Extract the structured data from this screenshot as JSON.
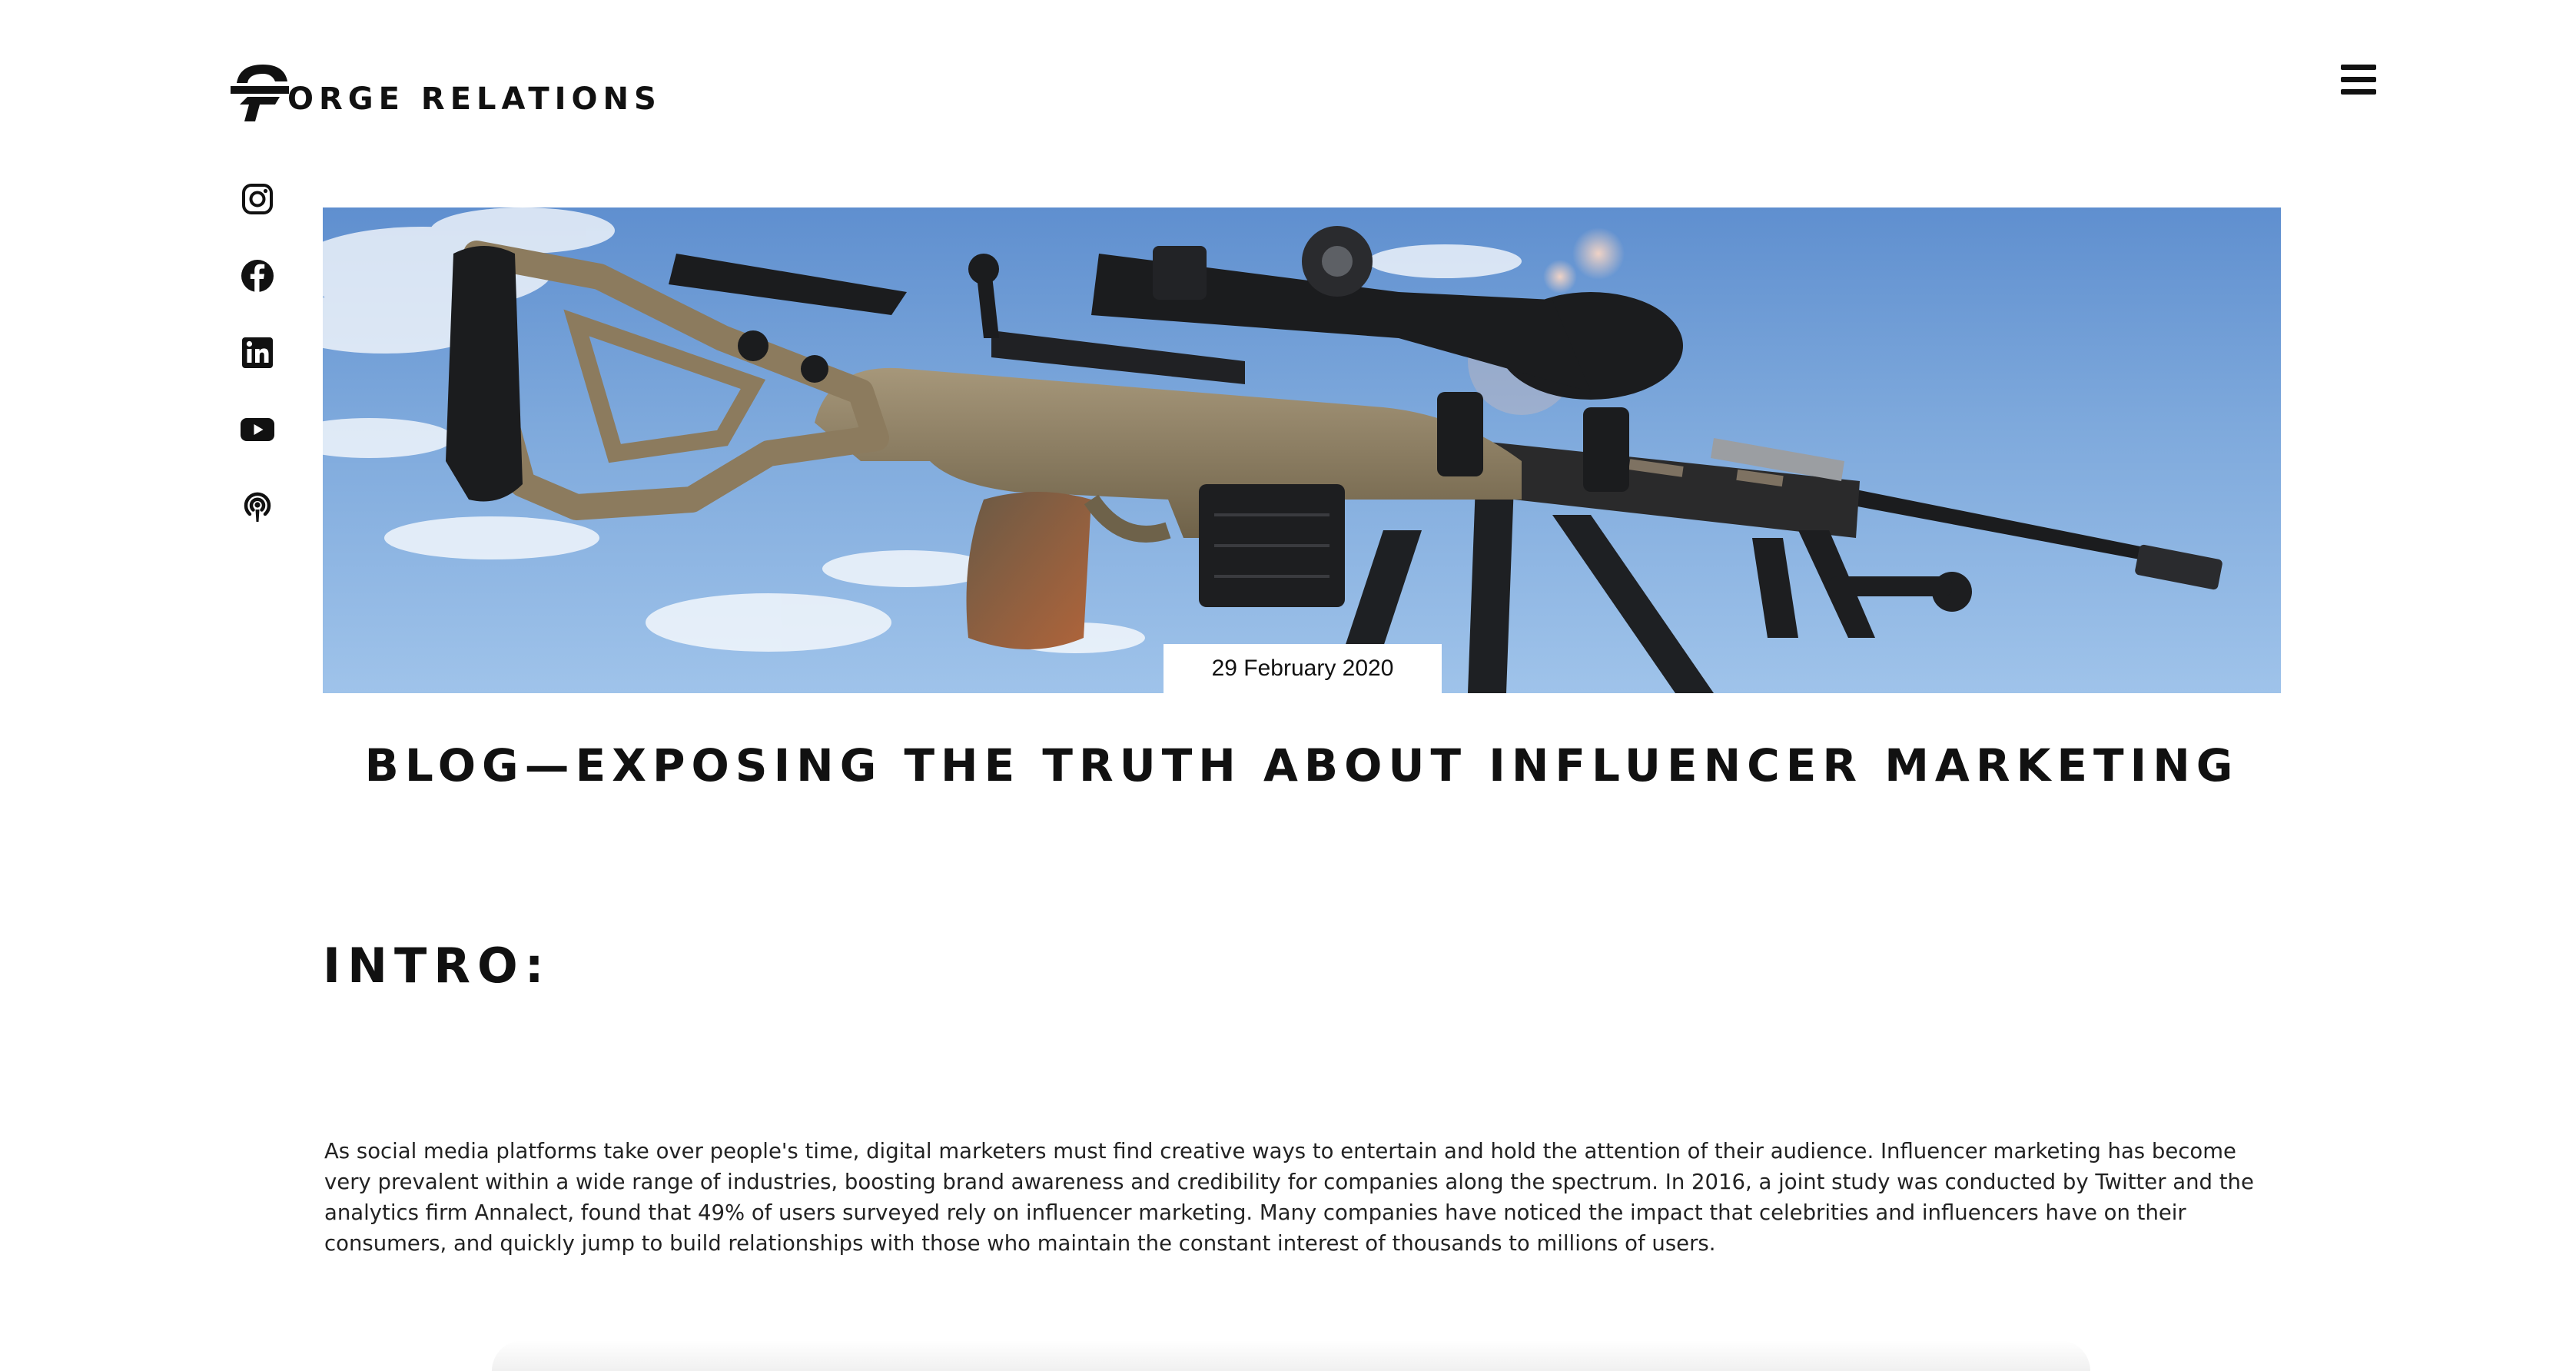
{
  "header": {
    "logo_text": "ORGE RELATIONS",
    "logo_icon": "forge-helmet-logo",
    "menu_icon": "hamburger-menu-icon"
  },
  "social": [
    {
      "name": "instagram-icon"
    },
    {
      "name": "facebook-icon"
    },
    {
      "name": "linkedin-icon"
    },
    {
      "name": "youtube-icon"
    },
    {
      "name": "podcast-icon"
    }
  ],
  "hero": {
    "image": "rifle-with-scope-against-sky",
    "date": "29 February 2020"
  },
  "post": {
    "title": "BLOG—EXPOSING THE TRUTH ABOUT INFLUENCER MARKETING",
    "intro_heading": "INTRO:",
    "intro_body": "As social media platforms take over people's time, digital marketers must find creative ways to entertain and hold the attention of their audience. Influencer marketing has become very prevalent within a wide range of industries, boosting brand awareness and credibility for companies along the spectrum. In 2016, a joint study was conducted by Twitter and the analytics firm Annalect, found that 49% of users surveyed rely on influencer marketing. Many companies have noticed the impact that celebrities and influencers have on their consumers, and quickly jump to build relationships with those who maintain the constant interest of thousands to millions of users."
  },
  "colors": {
    "text": "#111111",
    "sky_top": "#5f8fcf",
    "sky_bottom": "#9fc3ea",
    "rifle_tan": "#8c7b5e",
    "rifle_black": "#1b1c1e"
  }
}
